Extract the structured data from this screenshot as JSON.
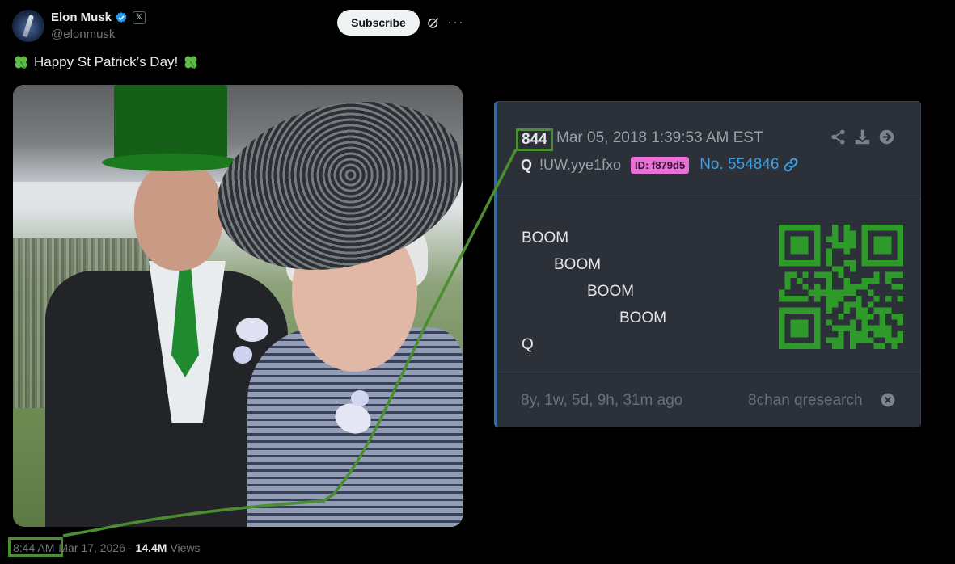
{
  "tweet": {
    "display_name": "Elon Musk",
    "handle": "@elonmusk",
    "subscribe_label": "Subscribe",
    "text": "Happy St Patrick’s Day!",
    "time": "8:44 AM",
    "date": "Mar 17, 2026",
    "separator": "·",
    "views_count": "14.4M",
    "views_label": "Views",
    "verified_color": "#1d9bf0"
  },
  "q_post": {
    "post_number": "844",
    "timestamp": "Mar 05, 2018 1:39:53 AM EST",
    "name": "Q",
    "tripcode": "!UW.yye1fxo",
    "id_badge": "ID: f879d5",
    "post_no": "No. 554846",
    "body_lines": [
      "BOOM",
      "BOOM",
      "BOOM",
      "BOOM",
      "Q"
    ],
    "age": "8y, 1w, 5d, 9h, 31m ago",
    "board": "8chan qresearch",
    "header_icons": [
      "share-icon",
      "download-icon",
      "arrow-right-circle-icon"
    ]
  },
  "highlight_color": "#4a8f2f",
  "accent_colors": {
    "id_badge": "#e76fd6",
    "post_link": "#3c9ee0",
    "card_border": "#3468a8"
  }
}
